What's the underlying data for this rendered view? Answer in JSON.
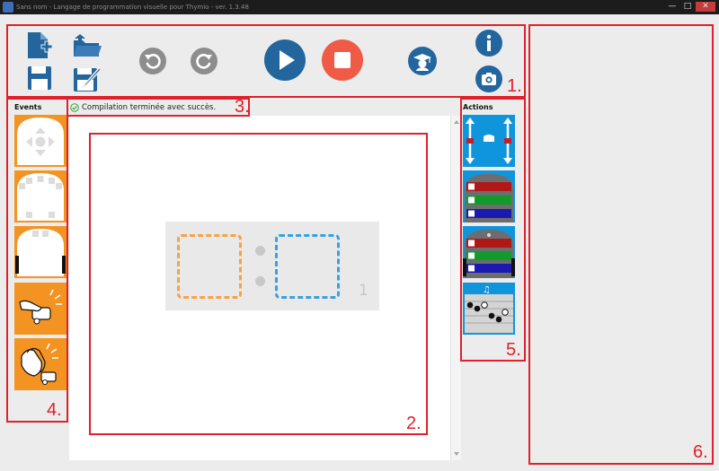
{
  "window": {
    "title": "Sans nom - Langage de programmation visuelle pour Thymio - ver. 1.3.48",
    "controls": {
      "minimize": "—",
      "maximize": "□",
      "close": "✕"
    }
  },
  "toolbar": {
    "icons": [
      "new-file-icon",
      "open-folder-icon",
      "save-icon",
      "save-as-icon",
      "undo-icon",
      "redo-icon",
      "run-icon",
      "stop-icon",
      "advanced-mode-icon",
      "info-icon",
      "screenshot-icon"
    ]
  },
  "status": {
    "message": "Compilation terminée avec succès."
  },
  "events": {
    "label": "Events",
    "blocks": [
      "buttons-event",
      "proximity-front-event",
      "proximity-ground-event",
      "tap-event",
      "clap-event"
    ]
  },
  "actions": {
    "label": "Actions",
    "blocks": [
      "motors-action",
      "top-color-action",
      "bottom-color-action",
      "music-action"
    ]
  },
  "editor": {
    "pair_number": "1"
  },
  "annotations": {
    "zones": [
      "1.",
      "2.",
      "3.",
      "4.",
      "5.",
      "6."
    ]
  },
  "colors": {
    "event_orange": "#f39322",
    "action_blue": "#0f95dc",
    "run_blue": "#23669e",
    "stop_red": "#f05b46",
    "annotation_red": "#e0202a"
  }
}
